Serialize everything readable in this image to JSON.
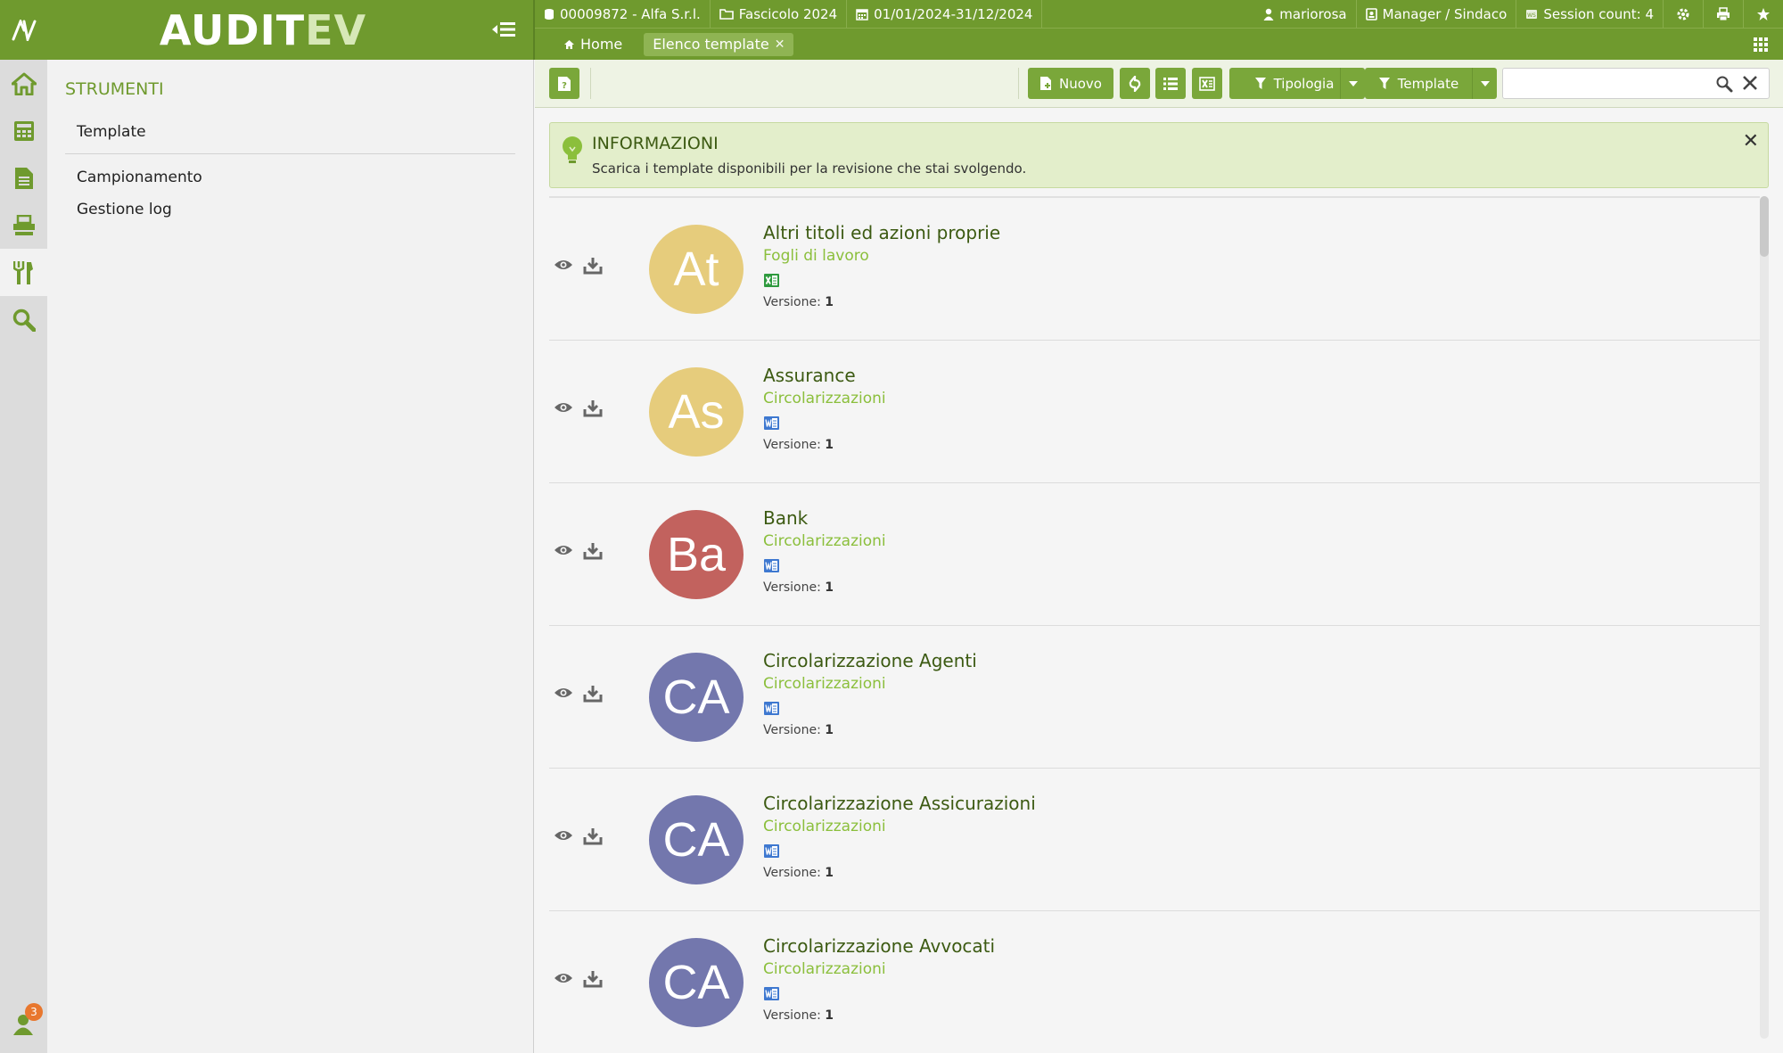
{
  "header": {
    "brand_main": "AUDIT",
    "brand_accent": "EV",
    "client": "00009872 - Alfa S.r.l.",
    "dossier": "Fascicolo 2024",
    "period": "01/01/2024-31/12/2024",
    "user": "mariorosa",
    "role": "Manager / Sindaco",
    "session": "Session count: 4"
  },
  "nav": {
    "home": "Home",
    "active_tab": "Elenco template"
  },
  "sidebar": {
    "title": "STRUMENTI",
    "items": [
      "Template",
      "Campionamento",
      "Gestione log"
    ],
    "notifications": "3"
  },
  "toolbar": {
    "new_label": "Nuovo",
    "filter_type_label": "Tipologia",
    "filter_template_label": "Template",
    "search_placeholder": ""
  },
  "alert": {
    "title": "INFORMAZIONI",
    "text": "Scarica i template disponibili per la revisione che stai svolgendo."
  },
  "version_label": "Versione:",
  "templates": [
    {
      "initials": "At",
      "name": "Altri titoli ed azioni proprie",
      "category": "Fogli di lavoro",
      "filetype": "excel",
      "version": "1",
      "color": "#e6cc7c"
    },
    {
      "initials": "As",
      "name": "Assurance",
      "category": "Circolarizzazioni",
      "filetype": "word",
      "version": "1",
      "color": "#e6cc7c"
    },
    {
      "initials": "Ba",
      "name": "Bank",
      "category": "Circolarizzazioni",
      "filetype": "word",
      "version": "1",
      "color": "#c2625e"
    },
    {
      "initials": "CA",
      "name": "Circolarizzazione Agenti",
      "category": "Circolarizzazioni",
      "filetype": "word",
      "version": "1",
      "color": "#7377ad"
    },
    {
      "initials": "CA",
      "name": "Circolarizzazione Assicurazioni",
      "category": "Circolarizzazioni",
      "filetype": "word",
      "version": "1",
      "color": "#7377ad"
    },
    {
      "initials": "CA",
      "name": "Circolarizzazione Avvocati",
      "category": "Circolarizzazioni",
      "filetype": "word",
      "version": "1",
      "color": "#7377ad"
    }
  ],
  "colors": {
    "brand_green": "#6f9a2e",
    "button_green": "#7aa73a",
    "link_green": "#8bbf3c",
    "alert_bg": "#e3eecb"
  }
}
